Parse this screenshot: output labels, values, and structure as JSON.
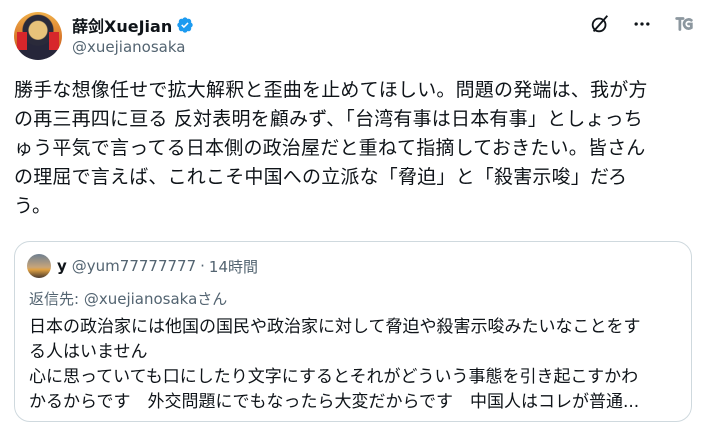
{
  "author": {
    "display_name": "薛剑XueJian",
    "handle": "@xuejianosaka"
  },
  "icons": [
    "verified-badge-icon",
    "grok-icon",
    "more-icon",
    "tg-logo-icon"
  ],
  "tweet": {
    "text": "勝手な想像任せで拡大解釈と歪曲を止めてほしい。問題の発端は、我が方\nの再三再四に亘る 反対表明を顧みず、「台湾有事は日本有事」としょっち\nゅう平気で言ってる日本側の政治屋だと重ねて指摘しておきたい。皆さん\nの理屈で言えば、これこそ中国への立派な「脅迫」と「殺害示唆」だろ\nう。"
  },
  "quoted": {
    "name": "y",
    "handle": "@yum77777777",
    "dot": "·",
    "time": "14時間",
    "reply_prefix": "返信先: ",
    "reply_to": "@xuejianosakaさん",
    "text": "日本の政治家には他国の国民や政治家に対して脅迫や殺害示唆みたいなことをす\nる人はいません\n心に思っていても口にしたり文字にするとそれがどういう事態を引き起こすかわ\nかるからです　外交問題にでもなったら大変だからです　中国人はコレが普通..."
  },
  "colors": {
    "verified": "#1d9bf0",
    "secondary_text": "#536471",
    "border": "#cfd9de"
  }
}
